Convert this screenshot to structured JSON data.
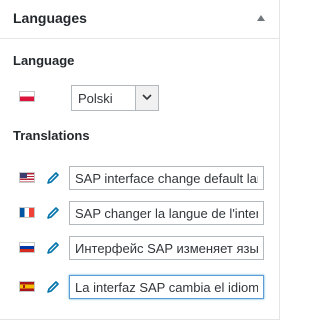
{
  "panel": {
    "title": "Languages",
    "toggle_icon": "triangle-up-icon"
  },
  "language": {
    "label": "Language",
    "flag": "pl-flag-icon",
    "selected": "Polski",
    "dropdown_icon": "chevron-down-icon"
  },
  "translations": {
    "label": "Translations",
    "items": [
      {
        "flag": "us-flag-icon",
        "edit_icon": "pencil-icon",
        "value": "SAP interface change default language"
      },
      {
        "flag": "fr-flag-icon",
        "edit_icon": "pencil-icon",
        "value": "SAP changer la langue de l'interface"
      },
      {
        "flag": "ru-flag-icon",
        "edit_icon": "pencil-icon",
        "value": "Интерфейс SAP изменяет язык"
      },
      {
        "flag": "es-flag-icon",
        "edit_icon": "pencil-icon",
        "value": "La interfaz SAP cambia el idioma"
      }
    ]
  },
  "colors": {
    "accent": "#0073aa",
    "border": "#e5e5e5",
    "focus": "#5b9dd9"
  }
}
